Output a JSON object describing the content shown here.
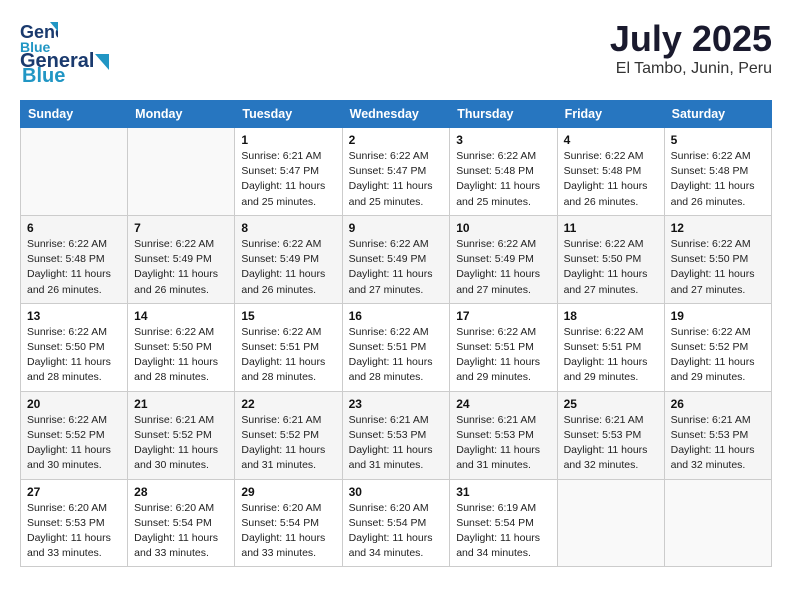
{
  "header": {
    "logo_general": "General",
    "logo_blue": "Blue",
    "title": "July 2025",
    "subtitle": "El Tambo, Junin, Peru"
  },
  "weekdays": [
    "Sunday",
    "Monday",
    "Tuesday",
    "Wednesday",
    "Thursday",
    "Friday",
    "Saturday"
  ],
  "weeks": [
    [
      {
        "day": "",
        "sunrise": "",
        "sunset": "",
        "daylight": ""
      },
      {
        "day": "",
        "sunrise": "",
        "sunset": "",
        "daylight": ""
      },
      {
        "day": "1",
        "sunrise": "Sunrise: 6:21 AM",
        "sunset": "Sunset: 5:47 PM",
        "daylight": "Daylight: 11 hours and 25 minutes."
      },
      {
        "day": "2",
        "sunrise": "Sunrise: 6:22 AM",
        "sunset": "Sunset: 5:47 PM",
        "daylight": "Daylight: 11 hours and 25 minutes."
      },
      {
        "day": "3",
        "sunrise": "Sunrise: 6:22 AM",
        "sunset": "Sunset: 5:48 PM",
        "daylight": "Daylight: 11 hours and 25 minutes."
      },
      {
        "day": "4",
        "sunrise": "Sunrise: 6:22 AM",
        "sunset": "Sunset: 5:48 PM",
        "daylight": "Daylight: 11 hours and 26 minutes."
      },
      {
        "day": "5",
        "sunrise": "Sunrise: 6:22 AM",
        "sunset": "Sunset: 5:48 PM",
        "daylight": "Daylight: 11 hours and 26 minutes."
      }
    ],
    [
      {
        "day": "6",
        "sunrise": "Sunrise: 6:22 AM",
        "sunset": "Sunset: 5:48 PM",
        "daylight": "Daylight: 11 hours and 26 minutes."
      },
      {
        "day": "7",
        "sunrise": "Sunrise: 6:22 AM",
        "sunset": "Sunset: 5:49 PM",
        "daylight": "Daylight: 11 hours and 26 minutes."
      },
      {
        "day": "8",
        "sunrise": "Sunrise: 6:22 AM",
        "sunset": "Sunset: 5:49 PM",
        "daylight": "Daylight: 11 hours and 26 minutes."
      },
      {
        "day": "9",
        "sunrise": "Sunrise: 6:22 AM",
        "sunset": "Sunset: 5:49 PM",
        "daylight": "Daylight: 11 hours and 27 minutes."
      },
      {
        "day": "10",
        "sunrise": "Sunrise: 6:22 AM",
        "sunset": "Sunset: 5:49 PM",
        "daylight": "Daylight: 11 hours and 27 minutes."
      },
      {
        "day": "11",
        "sunrise": "Sunrise: 6:22 AM",
        "sunset": "Sunset: 5:50 PM",
        "daylight": "Daylight: 11 hours and 27 minutes."
      },
      {
        "day": "12",
        "sunrise": "Sunrise: 6:22 AM",
        "sunset": "Sunset: 5:50 PM",
        "daylight": "Daylight: 11 hours and 27 minutes."
      }
    ],
    [
      {
        "day": "13",
        "sunrise": "Sunrise: 6:22 AM",
        "sunset": "Sunset: 5:50 PM",
        "daylight": "Daylight: 11 hours and 28 minutes."
      },
      {
        "day": "14",
        "sunrise": "Sunrise: 6:22 AM",
        "sunset": "Sunset: 5:50 PM",
        "daylight": "Daylight: 11 hours and 28 minutes."
      },
      {
        "day": "15",
        "sunrise": "Sunrise: 6:22 AM",
        "sunset": "Sunset: 5:51 PM",
        "daylight": "Daylight: 11 hours and 28 minutes."
      },
      {
        "day": "16",
        "sunrise": "Sunrise: 6:22 AM",
        "sunset": "Sunset: 5:51 PM",
        "daylight": "Daylight: 11 hours and 28 minutes."
      },
      {
        "day": "17",
        "sunrise": "Sunrise: 6:22 AM",
        "sunset": "Sunset: 5:51 PM",
        "daylight": "Daylight: 11 hours and 29 minutes."
      },
      {
        "day": "18",
        "sunrise": "Sunrise: 6:22 AM",
        "sunset": "Sunset: 5:51 PM",
        "daylight": "Daylight: 11 hours and 29 minutes."
      },
      {
        "day": "19",
        "sunrise": "Sunrise: 6:22 AM",
        "sunset": "Sunset: 5:52 PM",
        "daylight": "Daylight: 11 hours and 29 minutes."
      }
    ],
    [
      {
        "day": "20",
        "sunrise": "Sunrise: 6:22 AM",
        "sunset": "Sunset: 5:52 PM",
        "daylight": "Daylight: 11 hours and 30 minutes."
      },
      {
        "day": "21",
        "sunrise": "Sunrise: 6:21 AM",
        "sunset": "Sunset: 5:52 PM",
        "daylight": "Daylight: 11 hours and 30 minutes."
      },
      {
        "day": "22",
        "sunrise": "Sunrise: 6:21 AM",
        "sunset": "Sunset: 5:52 PM",
        "daylight": "Daylight: 11 hours and 31 minutes."
      },
      {
        "day": "23",
        "sunrise": "Sunrise: 6:21 AM",
        "sunset": "Sunset: 5:53 PM",
        "daylight": "Daylight: 11 hours and 31 minutes."
      },
      {
        "day": "24",
        "sunrise": "Sunrise: 6:21 AM",
        "sunset": "Sunset: 5:53 PM",
        "daylight": "Daylight: 11 hours and 31 minutes."
      },
      {
        "day": "25",
        "sunrise": "Sunrise: 6:21 AM",
        "sunset": "Sunset: 5:53 PM",
        "daylight": "Daylight: 11 hours and 32 minutes."
      },
      {
        "day": "26",
        "sunrise": "Sunrise: 6:21 AM",
        "sunset": "Sunset: 5:53 PM",
        "daylight": "Daylight: 11 hours and 32 minutes."
      }
    ],
    [
      {
        "day": "27",
        "sunrise": "Sunrise: 6:20 AM",
        "sunset": "Sunset: 5:53 PM",
        "daylight": "Daylight: 11 hours and 33 minutes."
      },
      {
        "day": "28",
        "sunrise": "Sunrise: 6:20 AM",
        "sunset": "Sunset: 5:54 PM",
        "daylight": "Daylight: 11 hours and 33 minutes."
      },
      {
        "day": "29",
        "sunrise": "Sunrise: 6:20 AM",
        "sunset": "Sunset: 5:54 PM",
        "daylight": "Daylight: 11 hours and 33 minutes."
      },
      {
        "day": "30",
        "sunrise": "Sunrise: 6:20 AM",
        "sunset": "Sunset: 5:54 PM",
        "daylight": "Daylight: 11 hours and 34 minutes."
      },
      {
        "day": "31",
        "sunrise": "Sunrise: 6:19 AM",
        "sunset": "Sunset: 5:54 PM",
        "daylight": "Daylight: 11 hours and 34 minutes."
      },
      {
        "day": "",
        "sunrise": "",
        "sunset": "",
        "daylight": ""
      },
      {
        "day": "",
        "sunrise": "",
        "sunset": "",
        "daylight": ""
      }
    ]
  ]
}
